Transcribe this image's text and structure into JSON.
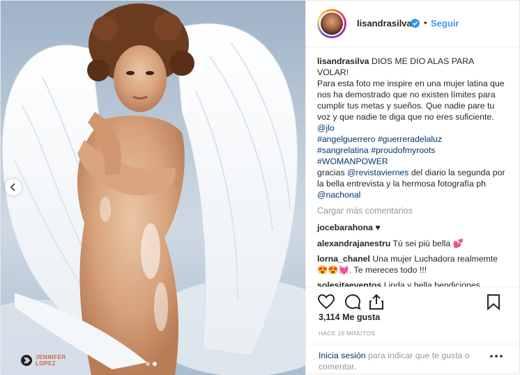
{
  "header": {
    "username": "lisandrasilva",
    "bullet": "•",
    "follow_label": "Seguir"
  },
  "caption": {
    "username": "lisandrasilva",
    "line1": "DIOS ME DIO ALAS PARA VOLAR!",
    "line2": "Para esta foto me inspire en una mujer latina que nos ha demostrado que no existen límites para cumplir tus metas y sueños. Que nadie pare tu voz y que nadie te diga que no eres suficiente.",
    "mention1": "@jlo",
    "hashtags1": "#angelguerrero #guerreradelaluz",
    "hashtags2": "#sangrelatina #proudofmyroots",
    "hashtags3": "#WOMANPOWER",
    "gracias": "gracias",
    "mention2": "@revistaviernes",
    "gracias_rest": "del diario la segunda por la bella entrevista y la hermosa fotografía ph",
    "mention3": "@nachonal"
  },
  "load_more": "Cargar más comentarios",
  "comments": [
    {
      "user": "jocebarahona",
      "text": "♥"
    },
    {
      "user": "alexandrajanestru",
      "text": "Tú sei più bella 💕"
    },
    {
      "user": "lorna_chanel",
      "text": "Una mujer Luchadora realmemte😍😍💓. Te mereces todo !!!"
    },
    {
      "user": "solesitaeventos",
      "text": "Linda y bella bendiciones"
    }
  ],
  "actions": {
    "like_icon": "heart-icon",
    "comment_icon": "comment-icon",
    "share_icon": "share-icon",
    "save_icon": "bookmark-icon"
  },
  "likes": "3,114 Me gusta",
  "time": "HACE 16 MINUTOS",
  "login": {
    "link": "Inicia sesión",
    "rest": "para indicar que te gusta o comentar."
  },
  "watermark": "JENNIFER LOPEZ",
  "carousel": {
    "total": 2,
    "active": 2
  },
  "colors": {
    "link_blue": "#3897f0",
    "mention_blue": "#003569",
    "muted": "#999999",
    "text": "#262626"
  }
}
